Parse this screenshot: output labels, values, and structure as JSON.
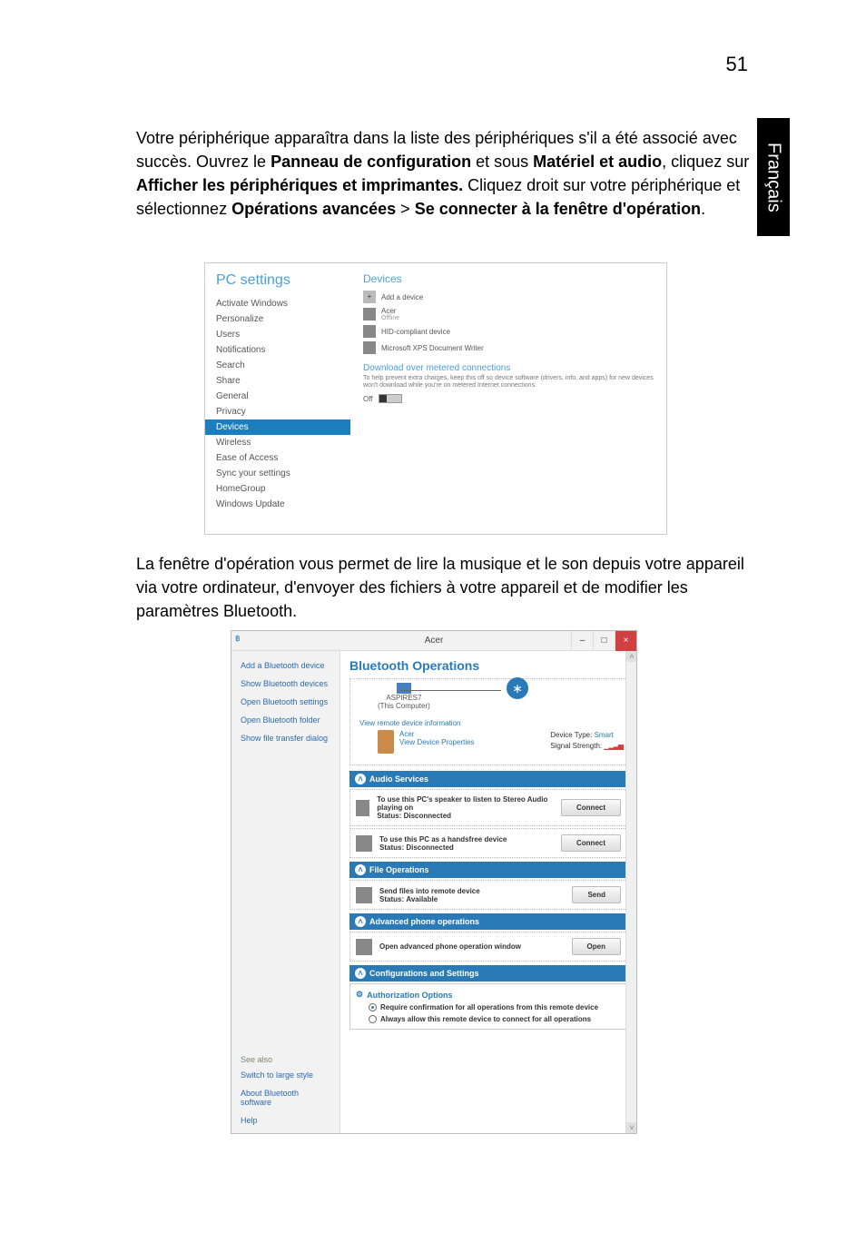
{
  "page_number": "51",
  "side_tab": "Français",
  "paragraph1_parts": [
    {
      "t": "Votre périphérique apparaîtra dans la liste des périphériques s'il a été associé avec succès. Ouvrez le "
    },
    {
      "t": "Panneau de configuration",
      "b": true
    },
    {
      "t": " et sous "
    },
    {
      "t": "Matériel et audio",
      "b": true
    },
    {
      "t": ", cliquez sur "
    },
    {
      "t": "Afficher les périphériques et imprimantes.",
      "b": true
    },
    {
      "t": " Cliquez droit sur votre périphérique et sélectionnez "
    },
    {
      "t": "Opérations avancées",
      "b": true
    },
    {
      "t": " > "
    },
    {
      "t": "Se connecter à la fenêtre d'opération",
      "b": true
    },
    {
      "t": "."
    }
  ],
  "paragraph2": "La fenêtre d'opération vous permet de lire la musique et le son depuis votre appareil via votre ordinateur, d'envoyer des fichiers à votre appareil et de modifier les paramètres Bluetooth.",
  "pc_settings": {
    "title": "PC settings",
    "devices_heading": "Devices",
    "nav": [
      "Activate Windows",
      "Personalize",
      "Users",
      "Notifications",
      "Search",
      "Share",
      "General",
      "Privacy",
      "Devices",
      "Wireless",
      "Ease of Access",
      "Sync your settings",
      "HomeGroup",
      "Windows Update"
    ],
    "active_nav": "Devices",
    "add_device": "Add a device",
    "device_list": [
      {
        "label": "Acer",
        "sub": "Offline"
      },
      {
        "label": "HID-compliant device"
      },
      {
        "label": "Microsoft XPS Document Writer"
      }
    ],
    "download_heading": "Download over metered connections",
    "download_desc": "To help prevent extra charges, keep this off so device software (drivers, info, and apps) for new devices won't download while you're on metered Internet connections.",
    "toggle_label": "Off"
  },
  "bt": {
    "window_title": "Acer",
    "panel_title": "Bluetooth Operations",
    "sidebar_links": [
      "Add a Bluetooth device",
      "Show Bluetooth devices",
      "Open Bluetooth settings",
      "Open Bluetooth folder",
      "Show file transfer dialog"
    ],
    "see_also_heading": "See also",
    "see_also_links": [
      "Switch to large style",
      "About Bluetooth software",
      "Help"
    ],
    "pc_name": "ASPIRES7",
    "pc_sub": "(This Computer)",
    "view_remote": "View remote device information",
    "remote_name": "Acer",
    "view_props": "View Device Properties",
    "device_type_label": "Device Type:",
    "device_type_value": "Smart",
    "signal_label": "Signal Strength:",
    "sections": {
      "audio": {
        "header": "Audio Services",
        "svc1_title": "To use this PC's speaker to listen to Stereo Audio playing on",
        "svc1_status_label": "Status:",
        "svc1_status": "Disconnected",
        "svc1_btn": "Connect",
        "svc2_title": "To use this PC as a handsfree device",
        "svc2_status_label": "Status:",
        "svc2_status": "Disconnected",
        "svc2_btn": "Connect"
      },
      "file": {
        "header": "File Operations",
        "svc_title": "Send files into remote device",
        "svc_status_label": "Status:",
        "svc_status": "Available",
        "svc_btn": "Send"
      },
      "phone": {
        "header": "Advanced phone operations",
        "svc_title": "Open advanced phone operation window",
        "svc_btn": "Open"
      },
      "cfg": {
        "header": "Configurations and Settings",
        "auth_title": "Authorization Options",
        "opt1": "Require confirmation for all operations from this remote device",
        "opt2": "Always allow this remote device to connect for all operations"
      }
    }
  }
}
